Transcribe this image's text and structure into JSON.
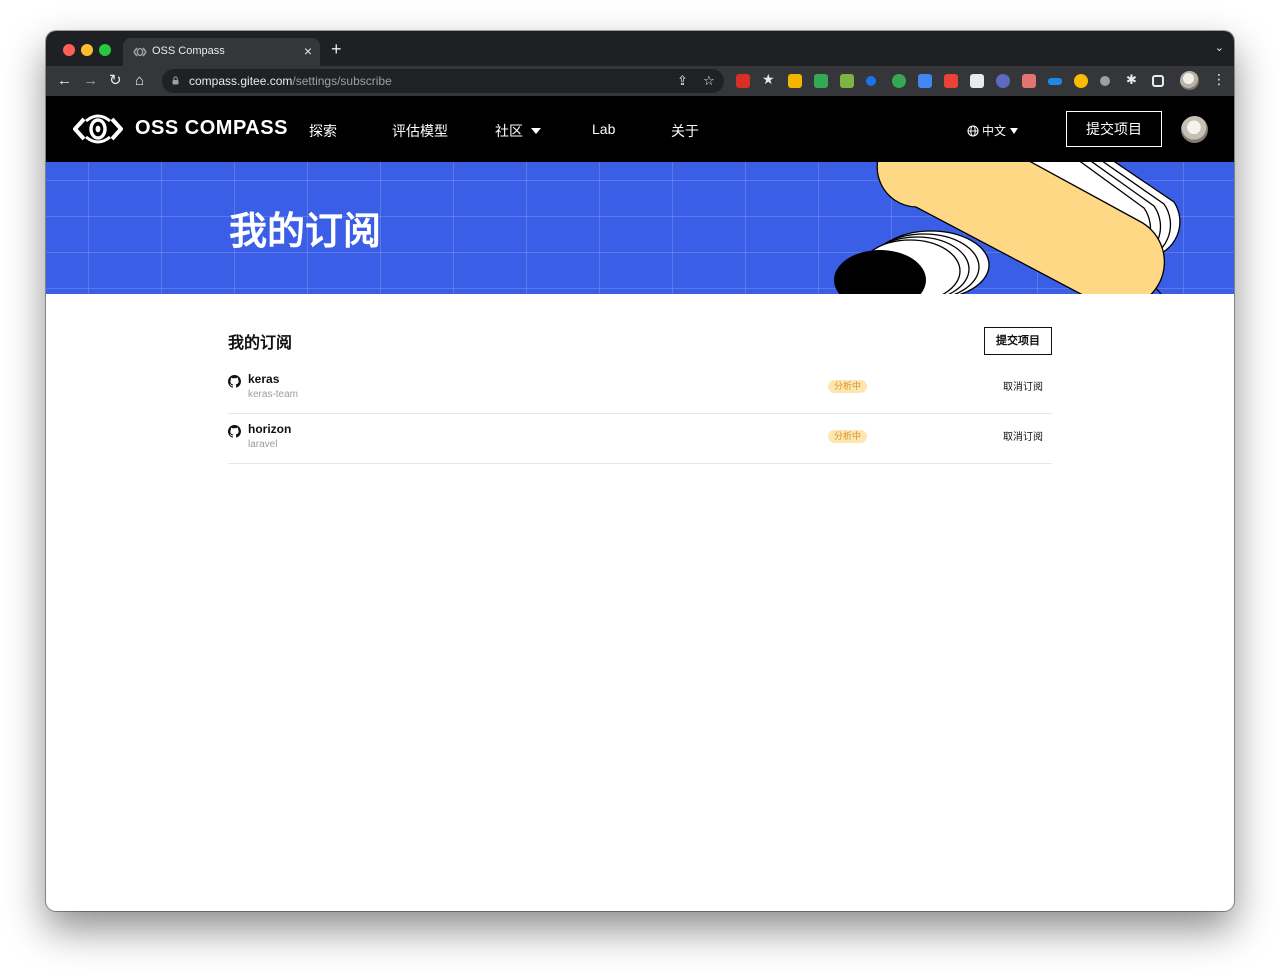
{
  "browser": {
    "tab_title": "OSS Compass",
    "tab_close": "×",
    "new_tab": "+",
    "tab_menu": "⌄",
    "url_host": "compass.gitee.com",
    "url_path": "/settings/subscribe",
    "nav": {
      "back": "←",
      "forward": "→",
      "reload": "↻",
      "home": "⌂"
    },
    "share_icon": "⇪",
    "star_icon": "☆",
    "menu_icon": "⋮"
  },
  "header": {
    "logo_text": "OSS COMPASS",
    "nav": {
      "explore": "探索",
      "models": "评估模型",
      "community": "社区",
      "lab": "Lab",
      "about": "关于"
    },
    "language": "中文",
    "submit_label": "提交项目"
  },
  "banner": {
    "title": "我的订阅"
  },
  "main": {
    "section_title": "我的订阅",
    "submit_label": "提交项目",
    "subscriptions": [
      {
        "name": "keras",
        "owner": "keras-team",
        "status": "分析中",
        "action": "取消订阅"
      },
      {
        "name": "horizon",
        "owner": "laravel",
        "status": "分析中",
        "action": "取消订阅"
      }
    ]
  },
  "colors": {
    "banner_blue": "#3b5ee6",
    "banner_yellow": "#ffd885",
    "status_bg": "#fde7b0",
    "status_text": "#d9902c"
  }
}
